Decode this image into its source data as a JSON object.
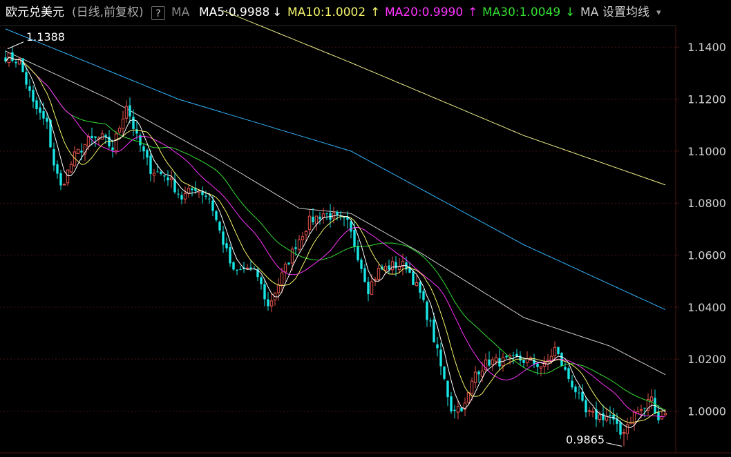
{
  "header": {
    "symbol": "欧元兑美元",
    "period": "(日线,前复权)",
    "help": "?",
    "indicator": "MA",
    "ma5": "MA5:0.9988",
    "ma10": "MA10:1.0002",
    "ma20": "MA20:0.9990",
    "ma30": "MA30:1.0049",
    "more": "MA",
    "settings": "设置均线",
    "arrow_down": "↓",
    "arrow_up": "↑",
    "dropdown": "▾"
  },
  "colors": {
    "background": "#000000",
    "up_candle": "#e5534b",
    "down_candle": "#19e6e6",
    "ma5": "#ffffff",
    "ma10": "#f5f56a",
    "ma20": "#ff33ff",
    "ma30": "#33dd33",
    "ma60": "#cfcfcf",
    "ma120": "#33b5ff",
    "ma250": "#f0f08a",
    "grid": "#4a1515",
    "axis_text": "#cfcfcf"
  },
  "chart_data": {
    "type": "candlestick",
    "y_ticks": [
      "1.1400",
      "1.1200",
      "1.1000",
      "1.0800",
      "1.0600",
      "1.0400",
      "1.0200",
      "1.0000"
    ],
    "ylim": [
      0.985,
      1.1475
    ],
    "annotations": [
      {
        "label": "1.1388",
        "value": 1.1388,
        "kind": "high",
        "index": 0
      },
      {
        "label": "0.9865",
        "value": 0.9865,
        "kind": "low",
        "index": 179
      }
    ],
    "bars_visible": 192,
    "series": [
      {
        "name": "MA5",
        "last": 0.9988
      },
      {
        "name": "MA10",
        "last": 1.0002
      },
      {
        "name": "MA20",
        "last": 0.999
      },
      {
        "name": "MA30",
        "last": 1.0049
      }
    ],
    "close_path": [
      [
        0,
        1.1365
      ],
      [
        4,
        1.1345
      ],
      [
        8,
        1.118
      ],
      [
        12,
        1.11
      ],
      [
        14,
        1.095
      ],
      [
        16,
        1.086
      ],
      [
        20,
        1.098
      ],
      [
        24,
        1.104
      ],
      [
        28,
        1.105
      ],
      [
        31,
        1.101
      ],
      [
        35,
        1.118
      ],
      [
        38,
        1.105
      ],
      [
        42,
        1.093
      ],
      [
        47,
        1.09
      ],
      [
        51,
        1.082
      ],
      [
        55,
        1.086
      ],
      [
        59,
        1.082
      ],
      [
        62,
        1.069
      ],
      [
        66,
        1.053
      ],
      [
        70,
        1.055
      ],
      [
        73,
        1.052
      ],
      [
        76,
        1.04
      ],
      [
        80,
        1.052
      ],
      [
        84,
        1.064
      ],
      [
        88,
        1.073
      ],
      [
        92,
        1.076
      ],
      [
        96,
        1.074
      ],
      [
        99,
        1.072
      ],
      [
        102,
        1.06
      ],
      [
        105,
        1.047
      ],
      [
        108,
        1.054
      ],
      [
        112,
        1.056
      ],
      [
        116,
        1.056
      ],
      [
        120,
        1.045
      ],
      [
        123,
        1.033
      ],
      [
        126,
        1.017
      ],
      [
        129,
        1.001
      ],
      [
        133,
        1.002
      ],
      [
        136,
        1.015
      ],
      [
        140,
        1.019
      ],
      [
        144,
        1.019
      ],
      [
        148,
        1.02
      ],
      [
        152,
        1.019
      ],
      [
        156,
        1.017
      ],
      [
        159,
        1.024
      ],
      [
        162,
        1.015
      ],
      [
        165,
        1.008
      ],
      [
        168,
        0.999
      ],
      [
        171,
        0.998
      ],
      [
        175,
        0.998
      ],
      [
        178,
        0.991
      ],
      [
        182,
        0.999
      ],
      [
        185,
        1.001
      ],
      [
        187,
        1.006
      ],
      [
        188,
        0.998
      ],
      [
        191,
        0.999
      ]
    ],
    "ma60_path": [
      [
        0,
        1.1385
      ],
      [
        30,
        1.12
      ],
      [
        60,
        1.098
      ],
      [
        85,
        1.078
      ],
      [
        100,
        1.076
      ],
      [
        120,
        1.061
      ],
      [
        150,
        1.036
      ],
      [
        175,
        1.025
      ],
      [
        191,
        1.014
      ]
    ],
    "ma120_path": [
      [
        0,
        1.147
      ],
      [
        50,
        1.12
      ],
      [
        100,
        1.1
      ],
      [
        150,
        1.064
      ],
      [
        191,
        1.039
      ]
    ],
    "ma250_path": [
      [
        63,
        1.154
      ],
      [
        100,
        1.134
      ],
      [
        150,
        1.106
      ],
      [
        191,
        1.087
      ]
    ]
  }
}
